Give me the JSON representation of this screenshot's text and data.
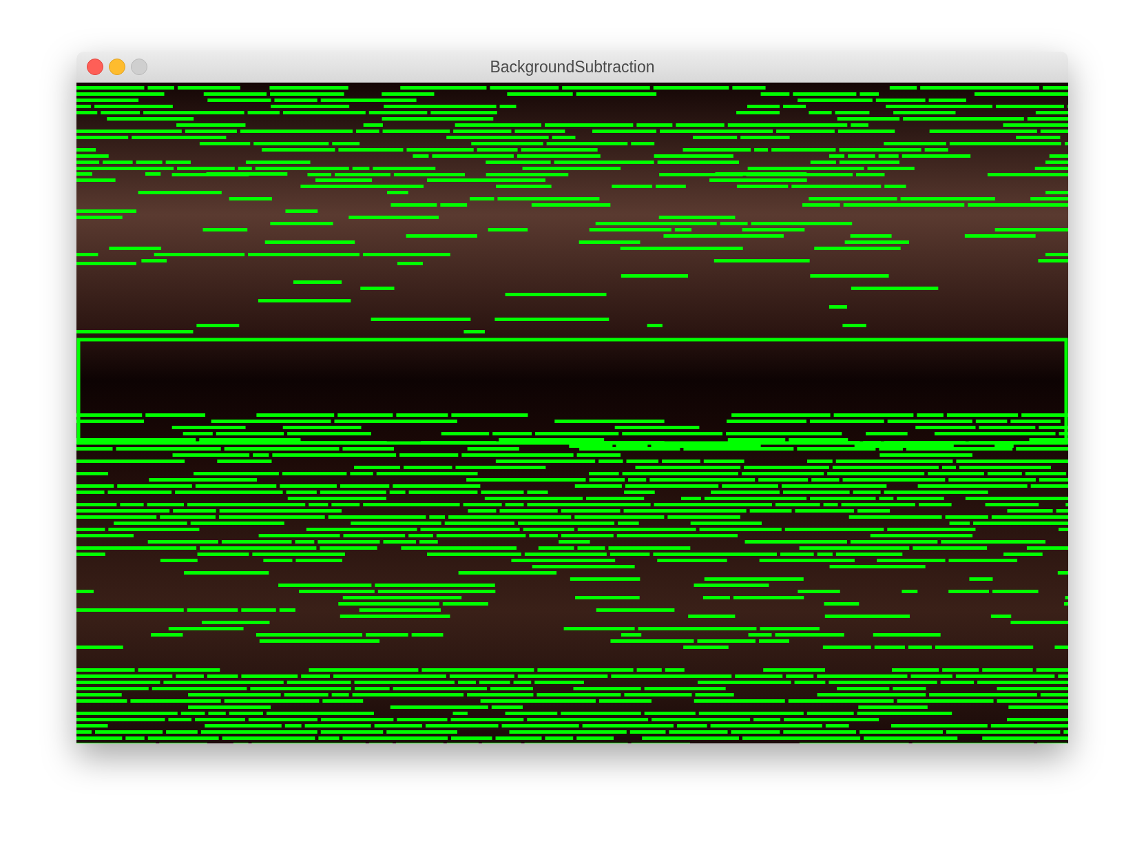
{
  "window": {
    "title": "BackgroundSubtraction",
    "buttons": [
      {
        "kind": "close",
        "disabled": false
      },
      {
        "kind": "minimize",
        "disabled": false
      },
      {
        "kind": "zoom",
        "disabled": true
      }
    ]
  }
}
